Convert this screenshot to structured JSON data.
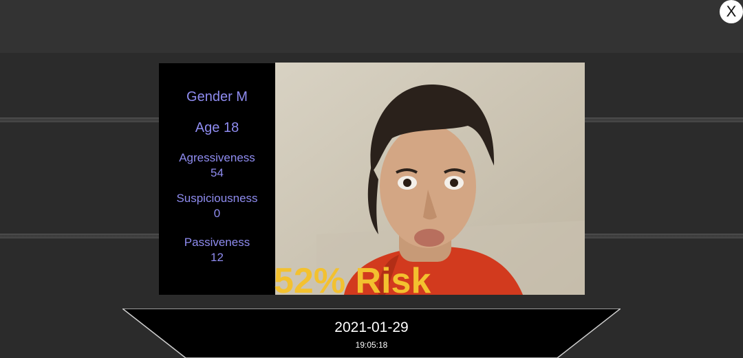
{
  "close_button": {
    "label": "X"
  },
  "profile": {
    "gender": "Gender M",
    "age": "Age 18",
    "aggressiveness_label": "Agressiveness",
    "aggressiveness_value": "54",
    "suspiciousness_label": "Suspiciousness",
    "suspiciousness_value": "0",
    "passiveness_label": "Passiveness",
    "passiveness_value": "12"
  },
  "risk": {
    "text": "52% Risk"
  },
  "timestamp": {
    "date": "2021-01-29",
    "time": "19:05:18"
  },
  "colors": {
    "panel_text": "#8f8cf0",
    "risk": "#f3c12f",
    "background": "#2e2e2e"
  }
}
